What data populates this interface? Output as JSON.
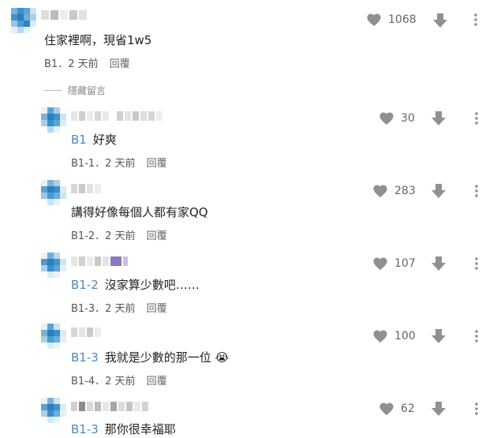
{
  "colors": {
    "accent": "#4a8bbf",
    "icon": "#909090"
  },
  "hidden_label": "隱藏留言",
  "comments": [
    {
      "text": "住家裡啊，現省1w5",
      "ref": "",
      "floor": "B1",
      "dot": "．",
      "age": "2 天前",
      "reply": "回覆",
      "likes": "1068"
    },
    {
      "text": "好爽",
      "ref": "B1",
      "floor": "B1-1",
      "dot": "．",
      "age": "2 天前",
      "reply": "回覆",
      "likes": "30"
    },
    {
      "text": "講得好像每個人都有家QQ",
      "ref": "",
      "floor": "B1-2",
      "dot": "．",
      "age": "2 天前",
      "reply": "回覆",
      "likes": "283"
    },
    {
      "text": "沒家算少數吧……",
      "ref": "B1-2",
      "floor": "B1-3",
      "dot": "．",
      "age": "2 天前",
      "reply": "回覆",
      "likes": "107"
    },
    {
      "text": "我就是少數的那一位",
      "ref": "B1-3",
      "floor": "B1-4",
      "dot": "．",
      "age": "2 天前",
      "reply": "回覆",
      "likes": "100",
      "emoji": "😭"
    },
    {
      "text": "那你很幸福耶",
      "ref": "B1-3",
      "floor": "",
      "dot": "",
      "age": "",
      "reply": "",
      "likes": "62"
    }
  ]
}
